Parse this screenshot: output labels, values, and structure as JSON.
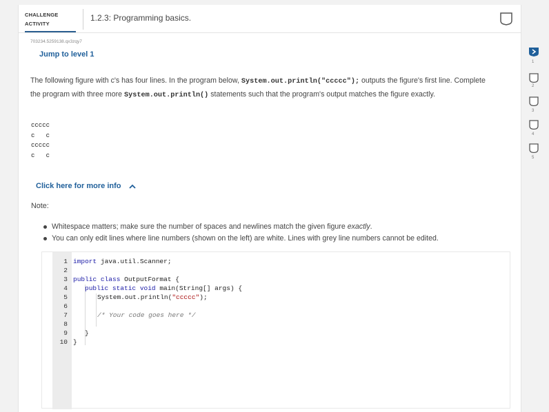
{
  "header": {
    "badge_line1": "CHALLENGE",
    "badge_line2": "ACTIVITY",
    "title": "1.2.3: Programming basics."
  },
  "activity": {
    "code_id": "703234.5259138.qx3zqy7",
    "level_link": "Jump to level 1",
    "desc_part1": "The following figure with c's has four lines. In the program below, ",
    "desc_code1": "System.out.println(\"ccccc\");",
    "desc_part2": " outputs the figure's first line. Complete the program with three more ",
    "desc_code2": "System.out.println()",
    "desc_part3": " statements such that the program's output matches the figure exactly.",
    "figure_lines": [
      "ccccc",
      "c   c",
      "ccccc",
      "c   c"
    ],
    "more_info": "Click here for more info",
    "note_label": "Note:",
    "bullet1_a": "Whitespace matters; make sure the number of spaces and newlines match the given figure ",
    "bullet1_b": "exactly",
    "bullet1_c": ".",
    "bullet2": "You can only edit lines where line numbers (shown on the left) are white. Lines with grey line numbers cannot be edited."
  },
  "editor": {
    "line_numbers": [
      "1",
      "2",
      "3",
      "4",
      "5",
      "6",
      "7",
      "8",
      "9",
      "10"
    ],
    "l1_kw": "import",
    "l1_rest": " java.util.Scanner;",
    "l3_kw": "public class",
    "l3_rest": " OutputFormat {",
    "l4_kw": "public static void",
    "l4_rest": " main(String[] args) {",
    "l5_a": "System.out.println(",
    "l5_str": "\"ccccc\"",
    "l5_b": ");",
    "l7_comment": "/* Your code goes here */",
    "l9": "}",
    "l10": "}"
  },
  "levels": {
    "step_numbers": [
      "1",
      "2",
      "3",
      "4",
      "5"
    ],
    "current_color": "#1f5f9a"
  }
}
